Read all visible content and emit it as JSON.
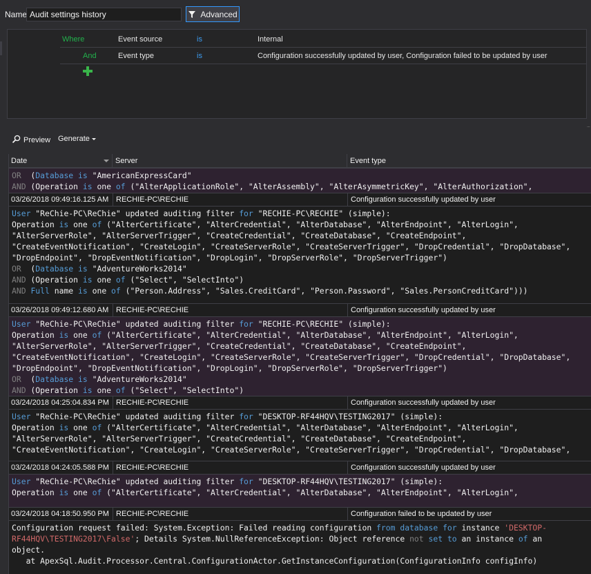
{
  "header": {
    "name_label": "Name",
    "name_value": "Audit settings history",
    "advanced_label": "Advanced"
  },
  "filter": {
    "rows": [
      {
        "connector": "Where",
        "field": "Event source",
        "operator": "is",
        "value": "Internal"
      },
      {
        "connector": "And",
        "field": "Event type",
        "operator": "is",
        "value": "Configuration successfully updated by user, Configuration failed to be updated by user"
      }
    ]
  },
  "toolbar": {
    "preview_label": "Preview",
    "generate_label": "Generate"
  },
  "grid": {
    "columns": [
      "Date",
      "Server",
      "Event type"
    ],
    "colors": {
      "selected": "#2e2230",
      "keyword": "#569cd6",
      "operator": "#808080",
      "error": "#d16969"
    },
    "entries": [
      {
        "date": "03/26/2018 09:49:16.125 AM",
        "server": "RECHIE-PC\\RECHIE",
        "event": "Configuration successfully updated by user"
      },
      {
        "date": "03/26/2018 09:49:12.680 AM",
        "server": "RECHIE-PC\\RECHIE",
        "event": "Configuration successfully updated by user"
      },
      {
        "date": "03/24/2018 04:25:04.834 PM",
        "server": "RECHIE-PC\\RECHIE",
        "event": "Configuration successfully updated by user"
      },
      {
        "date": "03/24/2018 04:24:05.588 PM",
        "server": "RECHIE-PC\\RECHIE",
        "event": "Configuration successfully updated by user"
      },
      {
        "date": "03/24/2018 04:18:50.950 PM",
        "server": "RECHIE-PC\\RECHIE",
        "event": "Configuration failed to be updated by user"
      }
    ]
  }
}
